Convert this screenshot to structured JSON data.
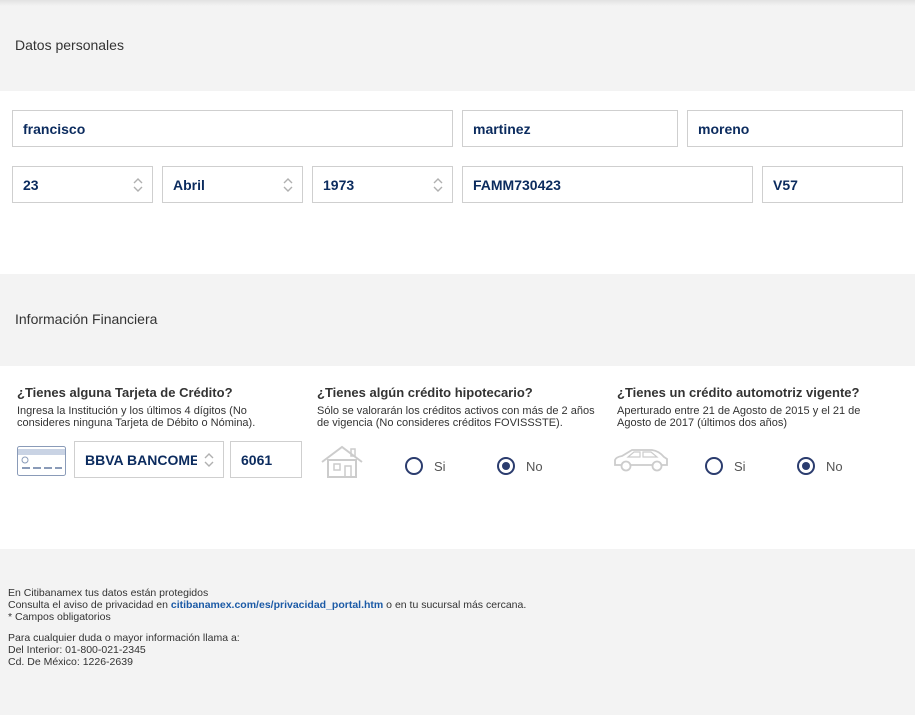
{
  "personal": {
    "title": "Datos personales",
    "nombre": "francisco",
    "apellido_paterno": "martinez",
    "apellido_materno": "moreno",
    "dia": "23",
    "mes": "Abril",
    "anio": "1973",
    "rfc": "FAMM730423",
    "homoclave": "V57"
  },
  "financial": {
    "title": "Información Financiera",
    "credit_card": {
      "question": "¿Tienes alguna Tarjeta de Crédito?",
      "help_1": "Ingresa la Institución y los últimos 4 dígitos (No",
      "help_2": "consideres ninguna Tarjeta de Débito o Nómina).",
      "institution": "BBVA BANCOMER",
      "last4": "6061"
    },
    "mortgage": {
      "question": "¿Tienes algún crédito hipotecario?",
      "help_1": "Sólo se valorarán los créditos activos con más de 2 años",
      "help_2": "de vigencia (No consideres créditos FOVISSSTE).",
      "yes_label": "Si",
      "no_label": "No",
      "selected": "No"
    },
    "auto": {
      "question": "¿Tienes un crédito automotriz vigente?",
      "help_1": "Aperturado entre 21 de Agosto de 2015 y el 21 de",
      "help_2": "Agosto de 2017 (últimos dos años)",
      "yes_label": "Si",
      "no_label": "No",
      "selected": "No"
    }
  },
  "footer": {
    "line1": "En Citibanamex tus datos están protegidos",
    "line2_pre": "Consulta el aviso de privacidad en ",
    "line2_link": "citibanamex.com/es/privacidad_portal.htm",
    "line2_post": " o en tu sucursal más cercana.",
    "line3": "* Campos obligatorios",
    "line4": "Para cualquier duda o mayor información llama a:",
    "line5": "Del Interior: 01-800-021-2345",
    "line6": "Cd. De México: 1226-2639"
  },
  "colors": {
    "accent": "#0b2b5e",
    "radio": "#2b3c6e",
    "band": "#f3f3f3",
    "link": "#1b5aa6"
  }
}
